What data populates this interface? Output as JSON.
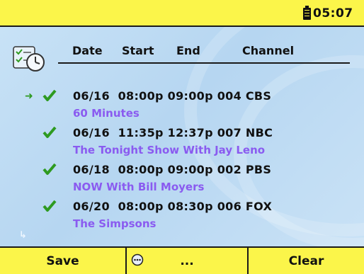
{
  "status": {
    "time": "05:07",
    "battery_icon": "battery-icon"
  },
  "header": {
    "app_icon": "scheduler-clock-icon",
    "columns": [
      "Date",
      "Start",
      "End",
      "Channel"
    ]
  },
  "recordings": [
    {
      "selected": true,
      "checked": true,
      "date": "06/16",
      "start": "08:00p",
      "end": "09:00p",
      "channel_num": "004",
      "channel_name": "CBS",
      "line": "06/16  08:00p 09:00p 004 CBS",
      "title": "60 Minutes"
    },
    {
      "selected": false,
      "checked": true,
      "date": "06/16",
      "start": "11:35p",
      "end": "12:37p",
      "channel_num": "007",
      "channel_name": "NBC",
      "line": "06/16  11:35p 12:37p 007 NBC",
      "title": "The Tonight Show With Jay Leno"
    },
    {
      "selected": false,
      "checked": true,
      "date": "06/18",
      "start": "08:00p",
      "end": "09:00p",
      "channel_num": "002",
      "channel_name": "PBS",
      "line": "06/18  08:00p 09:00p 002 PBS",
      "title": "NOW With Bill Moyers"
    },
    {
      "selected": false,
      "checked": true,
      "date": "06/20",
      "start": "08:00p",
      "end": "08:30p",
      "channel_num": "006",
      "channel_name": "FOX",
      "line": "06/20  08:00p 08:30p 006 FOX",
      "title": "The Simpsons"
    }
  ],
  "softkeys": {
    "left": "Save",
    "middle": "...",
    "right": "Clear"
  },
  "colors": {
    "bar": "#fbf54a",
    "background": "#c3dff5",
    "title_text": "#8a5bf0",
    "check": "#2e9a20"
  }
}
